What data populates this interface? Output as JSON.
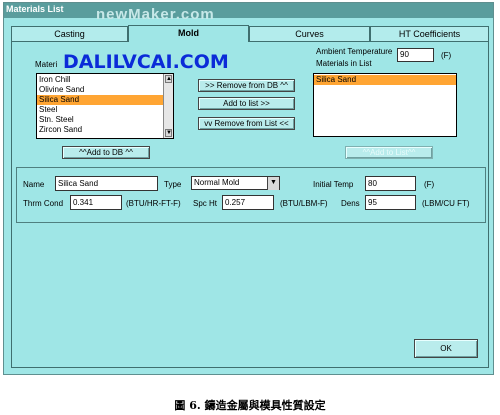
{
  "window": {
    "title": "Materials List",
    "watermark": "newMaker.com"
  },
  "tabs": [
    {
      "label": "Casting",
      "active": false
    },
    {
      "label": "Mold",
      "active": true
    },
    {
      "label": "Curves",
      "active": false
    },
    {
      "label": "HT Coefficients",
      "active": false
    }
  ],
  "overlay_watermark": "DALILVCAI.COM",
  "materials_db": {
    "label": "Materi",
    "items": [
      "Iron Chill",
      "Olivine Sand",
      "Silica Sand",
      "Steel",
      "Stn. Steel",
      "Zircon Sand"
    ],
    "selected": "Silica Sand"
  },
  "buttons": {
    "remove_from_db": ">> Remove from DB ^^",
    "add_to_list": "Add to list >>",
    "remove_from_list": "vv Remove from List <<",
    "add_to_db": "^^Add to DB ^^",
    "add_to_list_disabled": "^^Add to List^^",
    "ok": "OK"
  },
  "ambient": {
    "label": "Ambient Temperature",
    "value": "90",
    "unit": "(F)"
  },
  "materials_in_list": {
    "label": "Materials in List",
    "items": [
      "Silica Sand"
    ],
    "selected": "Silica Sand"
  },
  "properties": {
    "name_label": "Name",
    "name_value": "Silica Sand",
    "type_label": "Type",
    "type_value": "Normal Mold",
    "initial_temp_label": "Initial Temp",
    "initial_temp_value": "80",
    "initial_temp_unit": "(F)",
    "thrm_cond_label": "Thrm Cond",
    "thrm_cond_value": "0.341",
    "thrm_cond_unit": "(BTU/HR-FT-F)",
    "spc_ht_label": "Spc Ht",
    "spc_ht_value": "0.257",
    "spc_ht_unit": "(BTU/LBM-F)",
    "dens_label": "Dens",
    "dens_value": "95",
    "dens_unit": "(LBM/CU FT)"
  },
  "caption": "圖 6. 鑄造金屬與模具性質設定",
  "colors": {
    "window_bg": "#9fe6e6",
    "selection": "#ffa533",
    "titlebar": "#5a9d9d",
    "watermark_blue": "#0b2bd8"
  }
}
